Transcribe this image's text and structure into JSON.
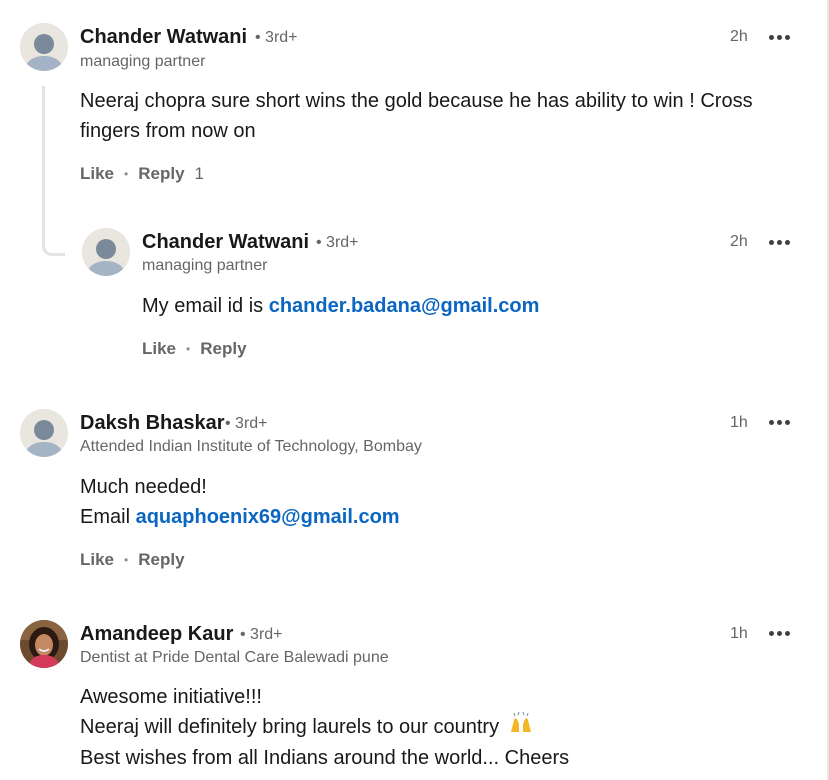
{
  "comments": [
    {
      "name": "Chander Watwani",
      "degree": "• 3rd+",
      "headline": "managing partner",
      "time": "2h",
      "text": "Neeraj chopra sure short wins the gold because he has ability to win ! Cross fingers from now on",
      "like": "Like",
      "reply": "Reply",
      "reply_count": "1",
      "avatar": "default-avatar"
    },
    {
      "name": "Chander Watwani",
      "degree": "• 3rd+",
      "headline": "managing partner",
      "time": "2h",
      "text_prefix": "My email id is ",
      "text_link": "chander.badana@gmail.com",
      "like": "Like",
      "reply": "Reply",
      "avatar": "default-avatar"
    },
    {
      "name": "Daksh Bhaskar",
      "degree": "• 3rd+",
      "headline": "Attended Indian Institute of Technology, Bombay",
      "time": "1h",
      "text_line1": "Much needed!",
      "text_prefix": "Email ",
      "text_link": "aquaphoenix69@gmail.com",
      "like": "Like",
      "reply": "Reply",
      "avatar": "default-avatar"
    },
    {
      "name": "Amandeep Kaur",
      "degree": "• 3rd+",
      "headline": "Dentist at Pride Dental Care Balewadi pune",
      "time": "1h",
      "text_line1": "Awesome initiative!!!",
      "text_line2": "Neeraj will definitely bring laurels to our country",
      "text_emoji": "raised-hands-emoji",
      "text_line3": "Best wishes from all Indians around the world... Cheers",
      "avatar": "profile-photo"
    }
  ],
  "icons": {
    "more": "more-options-icon",
    "default_avatar": "ghost-person-icon"
  },
  "colors": {
    "link": "#0a66c2",
    "secondary_text": "#666666",
    "primary_text": "#191919"
  }
}
